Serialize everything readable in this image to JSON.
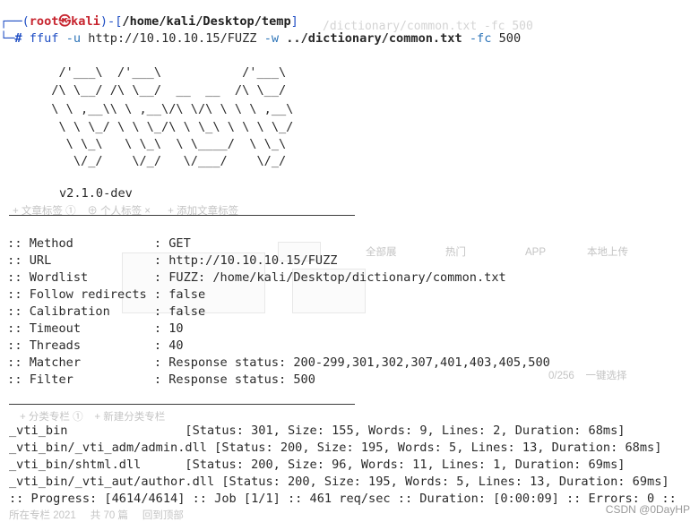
{
  "prompt": {
    "corner_top": "┌──",
    "open_paren": "(",
    "user": "root",
    "at_symbol": "㉿",
    "host": "kali",
    "close_paren_dash": ")-[",
    "path": "/home/kali/Desktop/temp",
    "close_bracket": "]",
    "corner_bottom": "└─",
    "hash": "#"
  },
  "command": {
    "program": "ffuf",
    "flag_u": "-u",
    "url": "http://10.10.10.15/FUZZ",
    "flag_w": "-w",
    "wordlist": "../dictionary/common.txt",
    "flag_fc": "-fc",
    "fc_value": "500"
  },
  "banner": {
    "art_lines": [
      "        /'___\\  /'___\\           /'___\\",
      "       /\\ \\__/ /\\ \\__/  __  __  /\\ \\__/",
      "       \\ \\ ,__\\\\ \\ ,__\\/\\ \\/\\ \\ \\ \\ ,__\\",
      "        \\ \\ \\_/ \\ \\ \\_/\\ \\ \\_\\ \\ \\ \\ \\_/",
      "         \\ \\_\\   \\ \\_\\  \\ \\____/  \\ \\_\\",
      "          \\/_/    \\/_/   \\/___/    \\/_/"
    ],
    "version": "v2.1.0-dev"
  },
  "config": [
    {
      "key": " :: Method           ",
      "value": ": GET"
    },
    {
      "key": " :: URL              ",
      "value": ": http://10.10.10.15/FUZZ"
    },
    {
      "key": " :: Wordlist         ",
      "value": ": FUZZ: /home/kali/Desktop/dictionary/common.txt"
    },
    {
      "key": " :: Follow redirects ",
      "value": ": false"
    },
    {
      "key": " :: Calibration      ",
      "value": ": false"
    },
    {
      "key": " :: Timeout          ",
      "value": ": 10"
    },
    {
      "key": " :: Threads          ",
      "value": ": 40"
    },
    {
      "key": " :: Matcher          ",
      "value": ": Response status: 200-299,301,302,307,401,403,405,500"
    },
    {
      "key": " :: Filter           ",
      "value": ": Response status: 500"
    }
  ],
  "results": [
    {
      "path": "_vti_bin                ",
      "details": "[Status: 301, Size: 155, Words: 9, Lines: 2, Duration: 68ms]"
    },
    {
      "path": "_vti_bin/_vti_adm/admin.dll ",
      "details": "[Status: 200, Size: 195, Words: 5, Lines: 13, Duration: 68ms]"
    },
    {
      "path": "_vti_bin/shtml.dll      ",
      "details": "[Status: 200, Size: 96, Words: 11, Lines: 1, Duration: 69ms]"
    },
    {
      "path": "_vti_bin/_vti_aut/author.dll ",
      "details": "[Status: 200, Size: 195, Words: 5, Lines: 13, Duration: 69ms]"
    }
  ],
  "progress_line": ":: Progress: [4614/4614] :: Job [1/1] :: 461 req/sec :: Duration: [0:00:09] :: Errors: 0 ::",
  "watermark": "CSDN @0DayHP"
}
